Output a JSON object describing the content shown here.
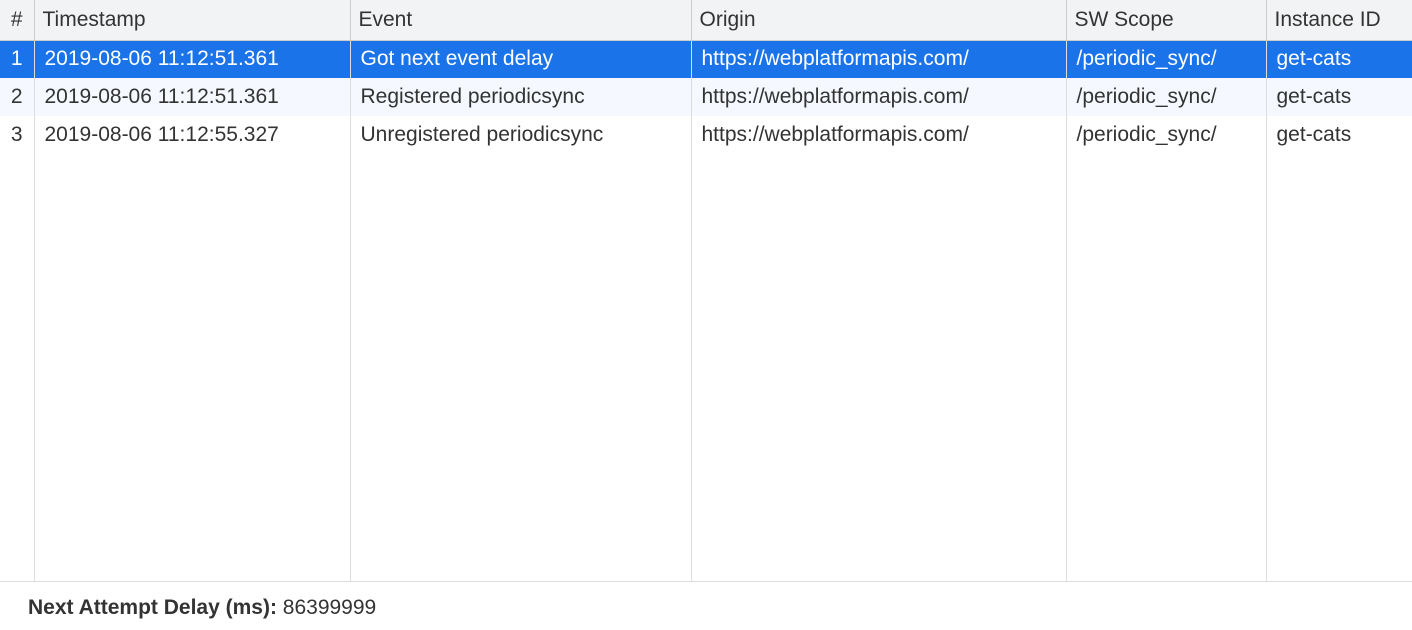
{
  "table": {
    "headers": {
      "num": "#",
      "timestamp": "Timestamp",
      "event": "Event",
      "origin": "Origin",
      "scope": "SW Scope",
      "instance": "Instance ID"
    },
    "rows": [
      {
        "num": "1",
        "timestamp": "2019-08-06 11:12:51.361",
        "event": "Got next event delay",
        "origin": "https://webplatformapis.com/",
        "scope": "/periodic_sync/",
        "instance": "get-cats",
        "selected": true
      },
      {
        "num": "2",
        "timestamp": "2019-08-06 11:12:51.361",
        "event": "Registered periodicsync",
        "origin": "https://webplatformapis.com/",
        "scope": "/periodic_sync/",
        "instance": "get-cats",
        "selected": false
      },
      {
        "num": "3",
        "timestamp": "2019-08-06 11:12:55.327",
        "event": "Unregistered periodicsync",
        "origin": "https://webplatformapis.com/",
        "scope": "/periodic_sync/",
        "instance": "get-cats",
        "selected": false
      }
    ]
  },
  "footer": {
    "label": "Next Attempt Delay (ms): ",
    "value": "86399999"
  }
}
